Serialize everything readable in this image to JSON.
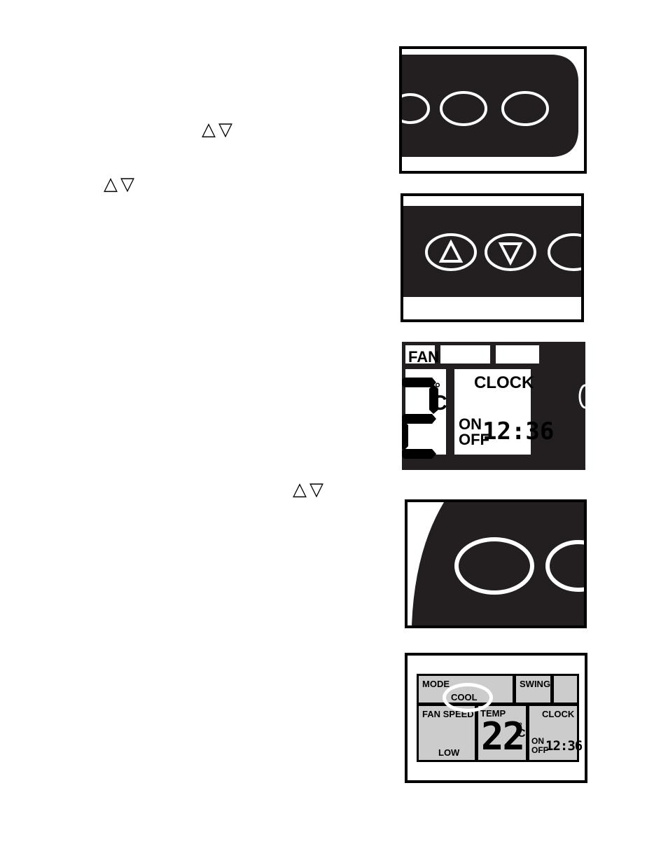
{
  "document": {
    "page_background": "#ffffff",
    "ink": "#000000",
    "remote_body_color": "#231f20",
    "lcd_background": "#cccccc"
  },
  "instruction_glyphs": [
    {
      "id": "glyph-pair-1",
      "up": "△",
      "down": "▽"
    },
    {
      "id": "glyph-pair-2",
      "up": "△",
      "down": "▽"
    },
    {
      "id": "glyph-pair-3",
      "up": "△",
      "down": "▽"
    }
  ],
  "figures": {
    "fig1": {
      "name": "remote-button-row-angled",
      "buttons": [
        "oval-button-partial",
        "oval-button",
        "oval-button"
      ]
    },
    "fig2": {
      "name": "remote-up-down-buttons",
      "buttons": [
        {
          "label": "△",
          "icon": "triangle-up-icon"
        },
        {
          "label": "▽",
          "icon": "triangle-down-icon"
        },
        {
          "label": "",
          "icon": "oval-button-partial"
        }
      ]
    },
    "fig3": {
      "name": "lcd-clock-zoom",
      "labels": {
        "fan": "FAN",
        "clock": "CLOCK",
        "on": "ON",
        "off": "OFF"
      },
      "temp_partial": "2",
      "unit": "°C",
      "degree": "°",
      "celsius": "C",
      "time": "12:36"
    },
    "fig4": {
      "name": "remote-single-button-zoom",
      "buttons": [
        "oval-button",
        "oval-button-partial"
      ]
    },
    "fig5": {
      "name": "lcd-full-display",
      "labels": {
        "mode": "MODE",
        "mode_value": "COOL",
        "swing": "SWING",
        "fan_speed": "FAN SPEED",
        "fan_speed_value": "LOW",
        "temp": "TEMP",
        "clock": "CLOCK",
        "on": "ON",
        "off": "OFF"
      },
      "temperature": "22",
      "degree": "°",
      "celsius": "C",
      "time": "12:36",
      "highlighted": "COOL"
    }
  }
}
